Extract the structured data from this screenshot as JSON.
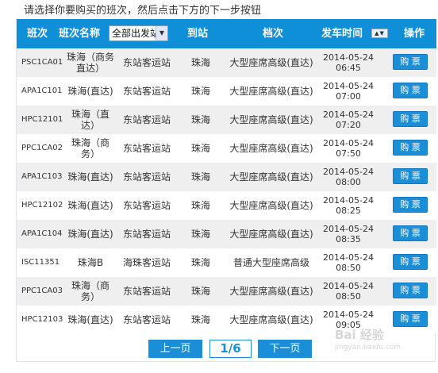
{
  "instruction": "请选择你要购买的班次，然后点击下方的下一步按钮",
  "header": {
    "code": "班次",
    "name": "班次名称",
    "station_select": "全部出发站",
    "to": "到站",
    "grade": "档次",
    "time": "发车时间",
    "action": "操作"
  },
  "rows": [
    {
      "code": "PSC1CA01",
      "name": "珠海（商务直达）",
      "from": "东站客运站",
      "to": "珠海",
      "grade": "大型座席高级(直达)",
      "date": "2014-05-24",
      "time": "06:45",
      "button": "购 票"
    },
    {
      "code": "APA1C101",
      "name": "珠海(直达)",
      "from": "东站客运站",
      "to": "珠海",
      "grade": "大型座席高级(直达)",
      "date": "2014-05-24",
      "time": "07:00",
      "button": "购 票"
    },
    {
      "code": "HPC12101",
      "name": "珠海（直达）",
      "from": "东站客运站",
      "to": "珠海",
      "grade": "大型座席高级(直达)",
      "date": "2014-05-24",
      "time": "07:20",
      "button": "购 票"
    },
    {
      "code": "PPC1CA02",
      "name": "珠海（商务）",
      "from": "东站客运站",
      "to": "珠海",
      "grade": "大型座席高级(直达)",
      "date": "2014-05-24",
      "time": "07:50",
      "button": "购 票"
    },
    {
      "code": "APA1C103",
      "name": "珠海(直达)",
      "from": "东站客运站",
      "to": "珠海",
      "grade": "大型座席高级(直达)",
      "date": "2014-05-24",
      "time": "08:00",
      "button": "购 票"
    },
    {
      "code": "HPC12102",
      "name": "珠海(直达)",
      "from": "东站客运站",
      "to": "珠海",
      "grade": "大型座席高级(直达)",
      "date": "2014-05-24",
      "time": "08:25",
      "button": "购 票"
    },
    {
      "code": "APA1C104",
      "name": "珠海(直达)",
      "from": "东站客运站",
      "to": "珠海",
      "grade": "大型座席高级(直达)",
      "date": "2014-05-24",
      "time": "08:35",
      "button": "购 票"
    },
    {
      "code": "ISC11351",
      "name": "珠海B",
      "from": "海珠客运站",
      "to": "珠海",
      "grade": "普通大型座席高级",
      "date": "2014-05-24",
      "time": "08:50",
      "button": "购 票"
    },
    {
      "code": "PPC1CA03",
      "name": "珠海（商务）",
      "from": "东站客运站",
      "to": "珠海",
      "grade": "大型座席高级(直达)",
      "date": "2014-05-24",
      "time": "08:50",
      "button": "购 票"
    },
    {
      "code": "HPC12103",
      "name": "珠海(直达)",
      "from": "东站客运站",
      "to": "珠海",
      "grade": "大型座席高级(直达)",
      "date": "2014-05-24",
      "time": "09:05",
      "button": "购 票"
    }
  ],
  "pager": {
    "prev": "上一页",
    "page": "1/6",
    "next": "下一页"
  },
  "watermark": {
    "text": "Bai 经验",
    "sub": "jingyan.baidu.com"
  }
}
